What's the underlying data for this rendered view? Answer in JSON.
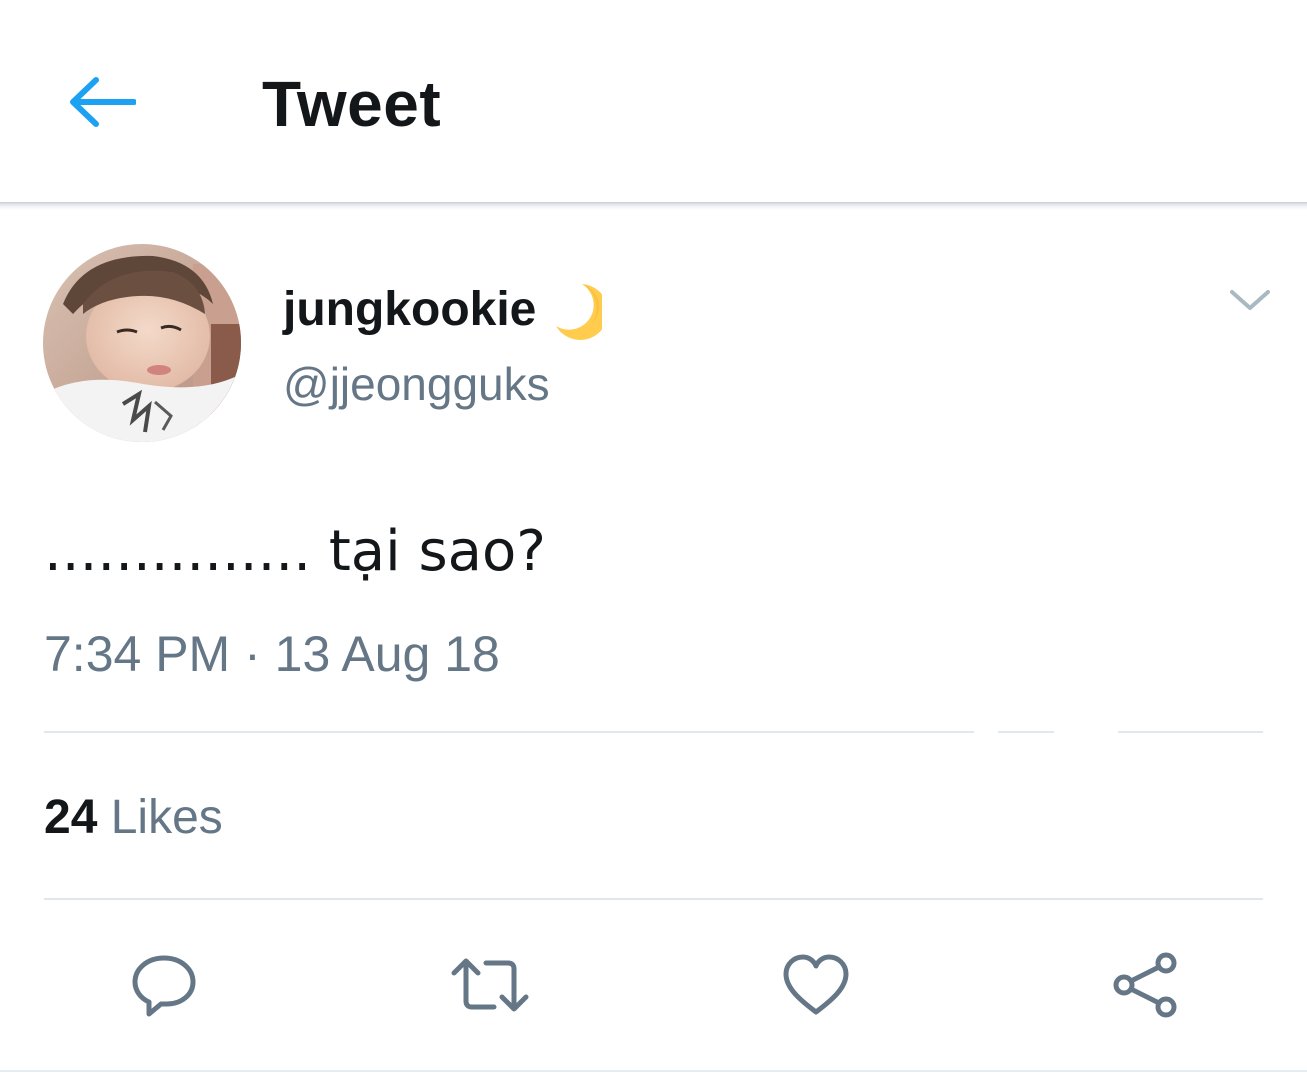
{
  "header": {
    "title": "Tweet",
    "back_icon": "arrow-left-icon"
  },
  "author": {
    "display_name": "jungkookie",
    "emoji_icon": "crescent-moon-icon",
    "handle": "@jjeongguks",
    "avatar": "profile-photo"
  },
  "tweet": {
    "text": "............... tại sao?",
    "timestamp": "7:34 PM · 13 Aug 18"
  },
  "stats": {
    "likes_count": "24",
    "likes_label": "Likes"
  },
  "actions": [
    {
      "name": "reply",
      "icon": "reply-icon"
    },
    {
      "name": "retweet",
      "icon": "retweet-icon"
    },
    {
      "name": "like",
      "icon": "heart-icon"
    },
    {
      "name": "share",
      "icon": "share-icon"
    }
  ],
  "colors": {
    "accent": "#1da1f2",
    "text_primary": "#14171a",
    "text_secondary": "#657786",
    "divider": "#e1e8ed",
    "moon": "#ffcc4d"
  }
}
